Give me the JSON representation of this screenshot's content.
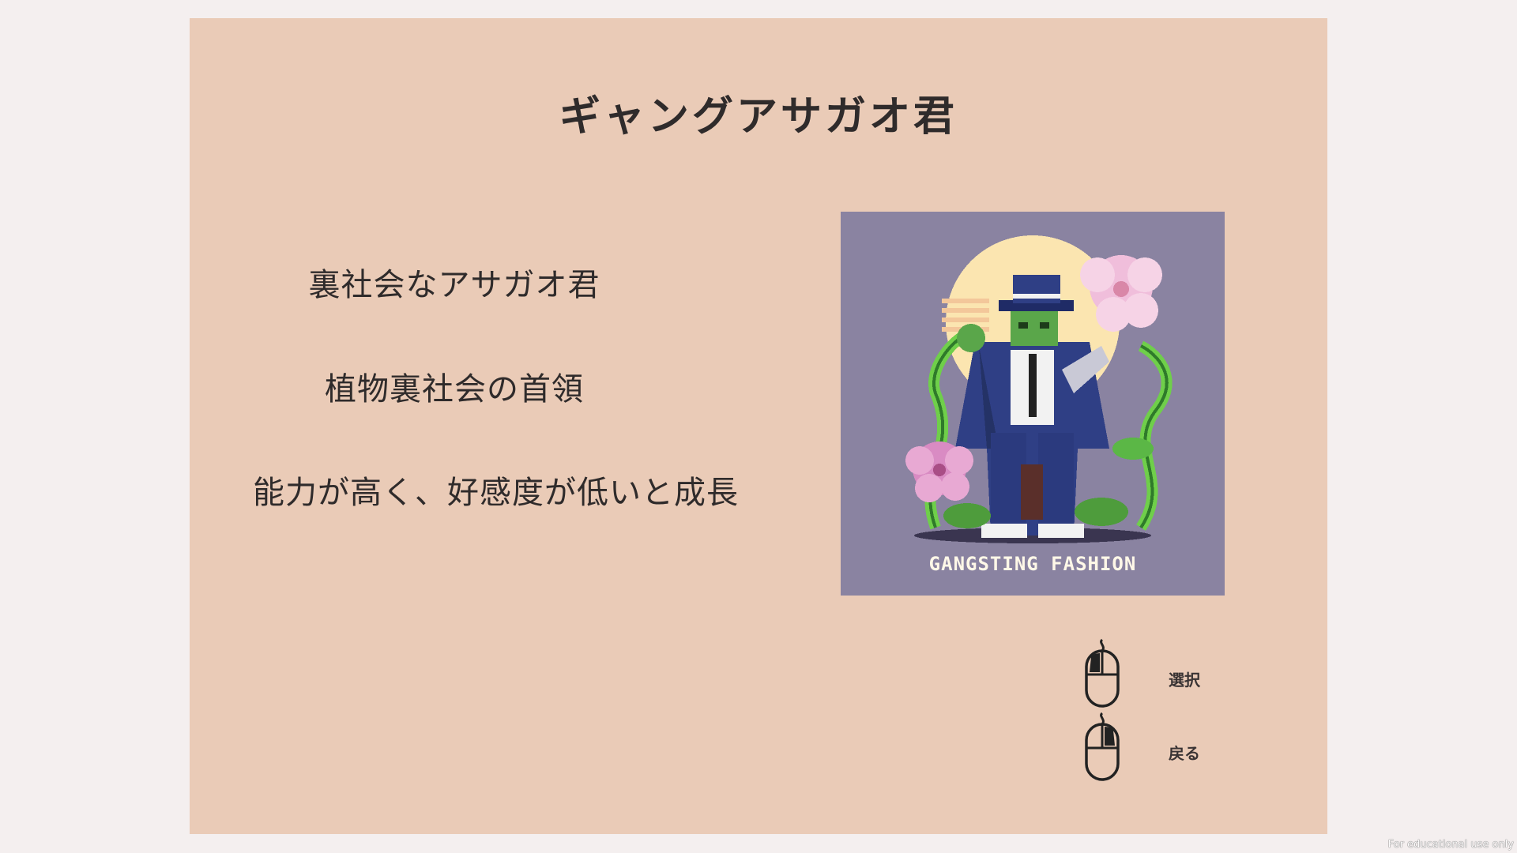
{
  "card": {
    "title": "ギャングアサガオ君",
    "descriptions": [
      "裏社会なアサガオ君",
      "植物裏社会の首領",
      "能力が高く、好感度が低いと成長"
    ],
    "image": {
      "caption": "GANGSTING FASHION",
      "background": "#8a83a1"
    }
  },
  "controls": [
    {
      "icon": "mouse-left-click-icon",
      "label": "選択"
    },
    {
      "icon": "mouse-right-click-icon",
      "label": "戻る"
    }
  ],
  "watermark": "For educational use only",
  "colors": {
    "page_background": "#f4efef",
    "panel_background": "#eacbb7",
    "text": "#2f2b2b"
  }
}
